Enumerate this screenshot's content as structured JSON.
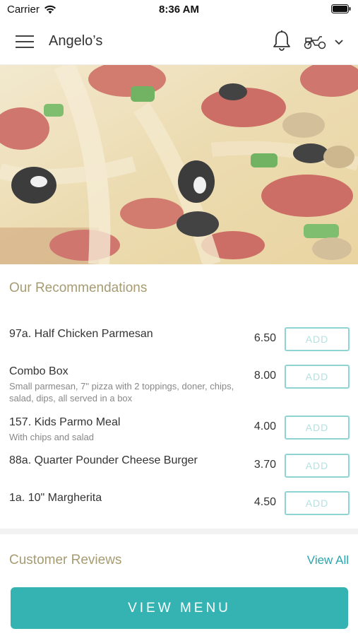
{
  "status_bar": {
    "carrier": "Carrier",
    "time": "8:36 AM"
  },
  "header": {
    "title": "Angelo’s"
  },
  "recommendations": {
    "title": "Our Recommendations",
    "add_label": "ADD",
    "items": [
      {
        "name": "97a. Half Chicken Parmesan",
        "description": "",
        "price": "6.50"
      },
      {
        "name": "Combo Box",
        "description": "Small parmesan, 7\" pizza with 2 toppings, doner, chips, salad, dips, all served in a box",
        "price": "8.00"
      },
      {
        "name": "157. Kids Parmo Meal",
        "description": "With chips and salad",
        "price": "4.00"
      },
      {
        "name": "88a. Quarter Pounder Cheese Burger",
        "description": "",
        "price": "3.70"
      },
      {
        "name": "1a. 10\" Margherita",
        "description": "",
        "price": "4.50"
      }
    ]
  },
  "reviews": {
    "title": "Customer Reviews",
    "view_all": "View All"
  },
  "footer": {
    "view_menu": "VIEW MENU"
  },
  "colors": {
    "accent": "#35b3b3",
    "section_title": "#a69b72",
    "link": "#2aa6b0",
    "add_border": "#8fd3d3"
  }
}
